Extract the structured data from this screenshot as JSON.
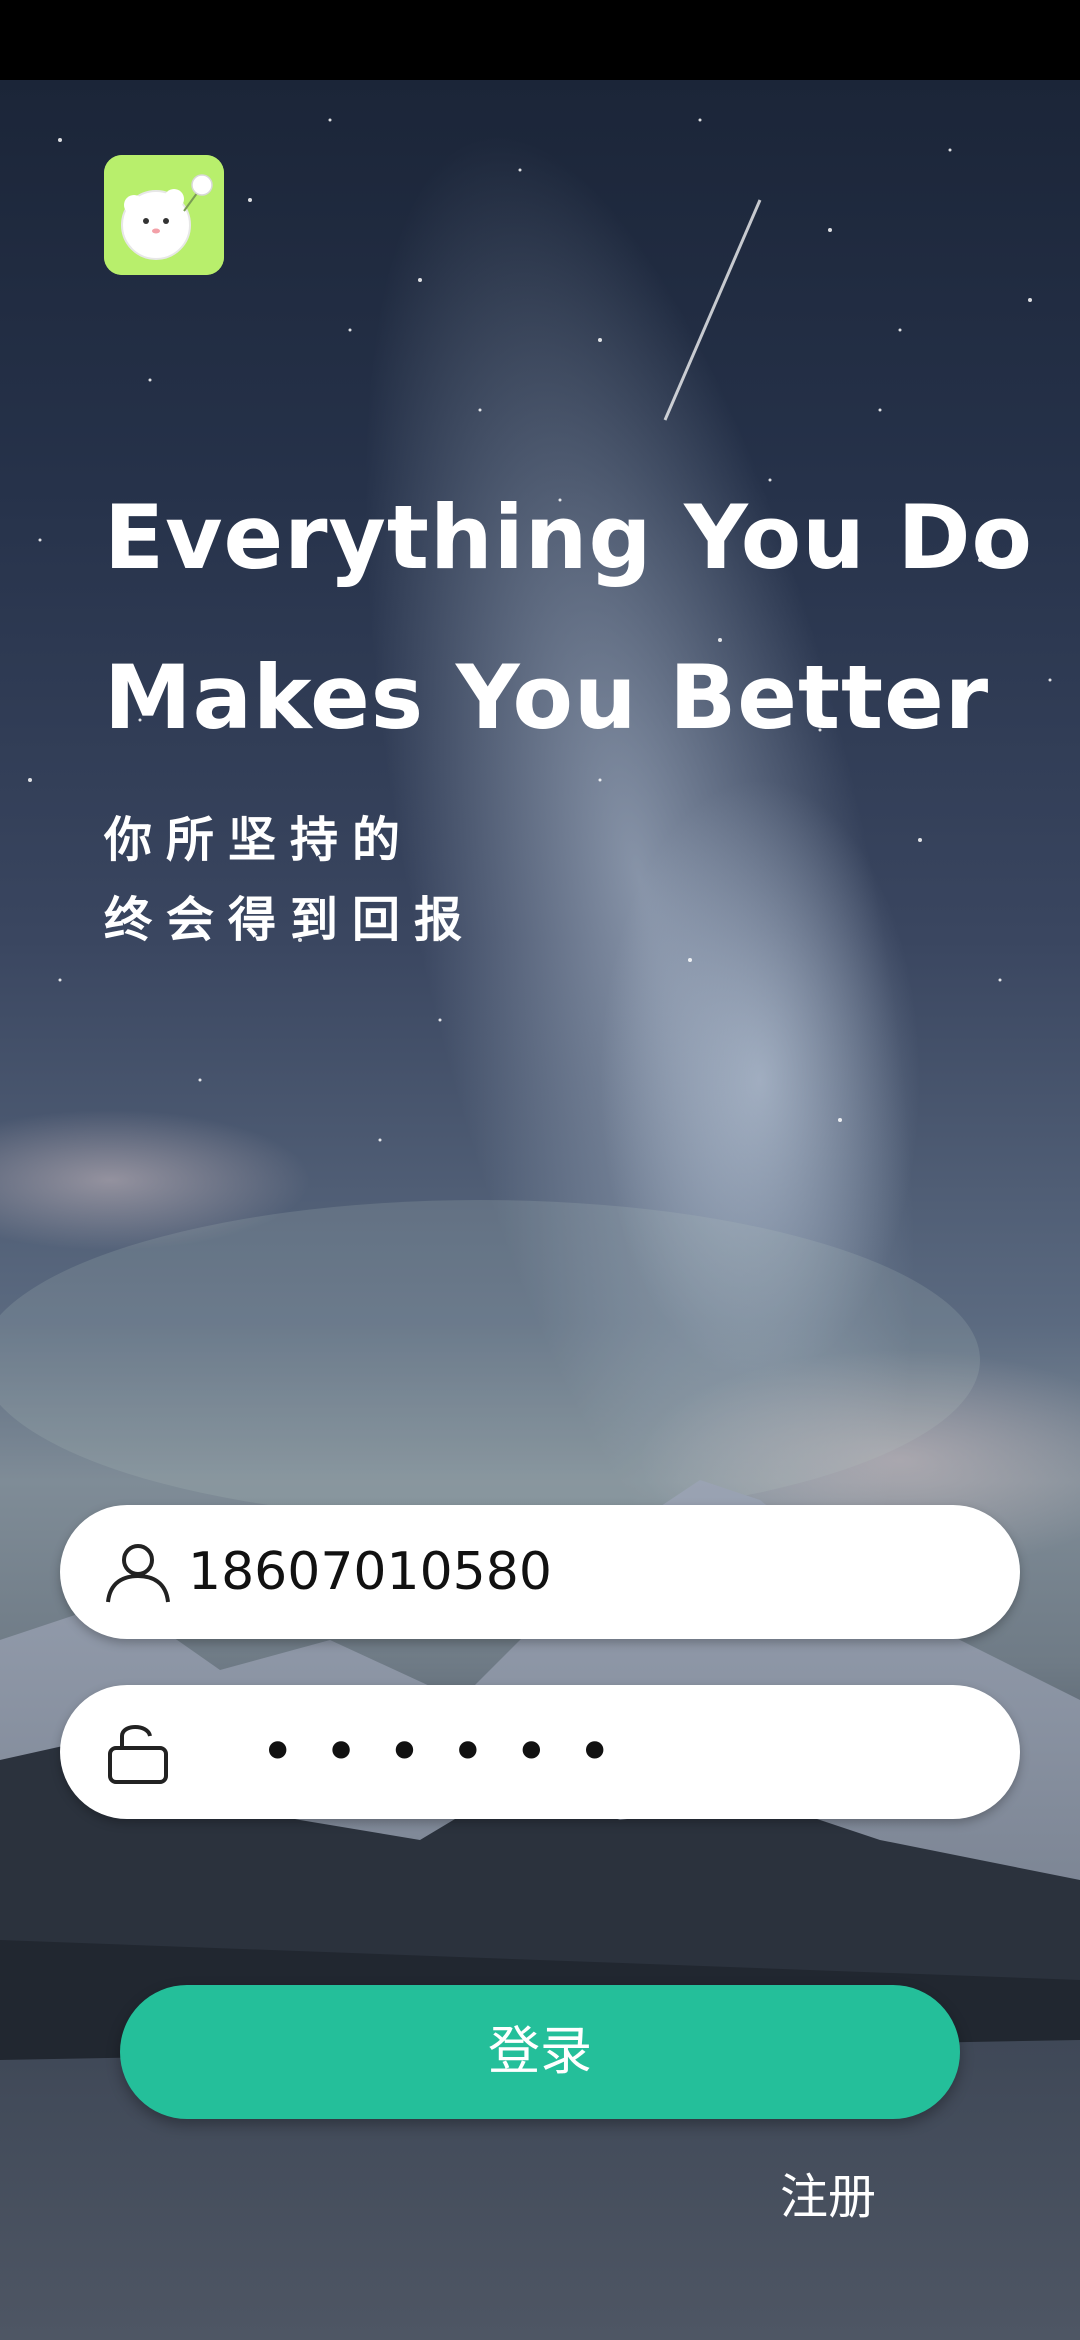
{
  "header": {
    "logo_icon": "fluffy-hamster-app-icon",
    "logo_color": "#b8ef6c"
  },
  "headline": {
    "line1": "Everything You Do",
    "line2": "Makes You Better"
  },
  "subline": {
    "line1": "你所坚持的",
    "line2": "终会得到回报"
  },
  "form": {
    "username": {
      "icon": "user-icon",
      "value": "18607010580"
    },
    "password": {
      "icon": "unlocked-lock-icon",
      "value": "••••••"
    },
    "login_label": "登录",
    "register_label": "注册"
  },
  "colors": {
    "accent": "#24bf9a",
    "field_background": "#ffffff",
    "text_light": "#ffffff"
  }
}
